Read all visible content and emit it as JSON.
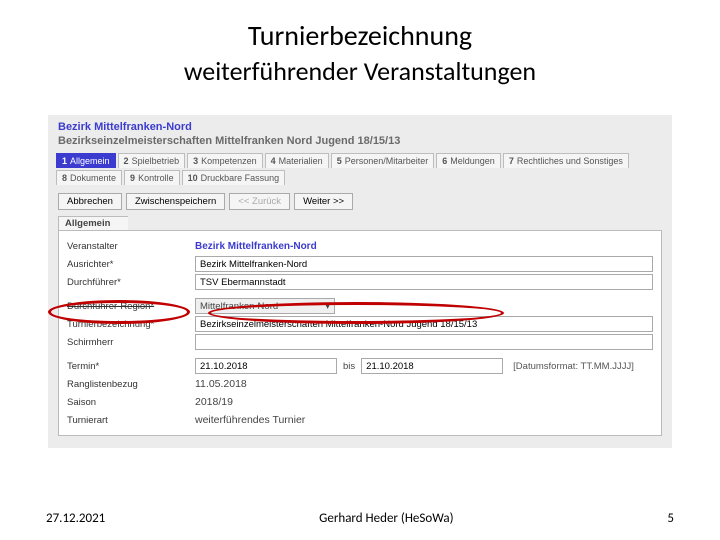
{
  "title": {
    "main": "Turnierbezeichnung",
    "sub": "weiterführender Veranstaltungen"
  },
  "header": {
    "region": "Bezirk Mittelfranken-Nord",
    "tournament": "Bezirkseinzelmeisterschaften Mittelfranken Nord Jugend 18/15/13"
  },
  "tabs": [
    {
      "num": "1",
      "label": "Allgemein",
      "active": true
    },
    {
      "num": "2",
      "label": "Spielbetrieb",
      "active": false
    },
    {
      "num": "3",
      "label": "Kompetenzen",
      "active": false
    },
    {
      "num": "4",
      "label": "Materialien",
      "active": false
    },
    {
      "num": "5",
      "label": "Personen/Mitarbeiter",
      "active": false
    },
    {
      "num": "6",
      "label": "Meldungen",
      "active": false
    },
    {
      "num": "7",
      "label": "Rechtliches und Sonstiges",
      "active": false
    },
    {
      "num": "8",
      "label": "Dokumente",
      "active": false
    },
    {
      "num": "9",
      "label": "Kontrolle",
      "active": false
    },
    {
      "num": "10",
      "label": "Druckbare Fassung",
      "active": false
    }
  ],
  "buttons": {
    "cancel": "Abbrechen",
    "save_interim": "Zwischenspeichern",
    "back": "<< Zurück",
    "next": "Weiter >>"
  },
  "section": {
    "general": "Allgemein"
  },
  "form": {
    "veranstalter_lbl": "Veranstalter",
    "veranstalter_val": "Bezirk Mittelfranken-Nord",
    "ausrichter_lbl": "Ausrichter*",
    "ausrichter_val": "Bezirk Mittelfranken-Nord",
    "durchfuehrer_lbl": "Durchführer*",
    "durchfuehrer_val": "TSV Ebermannstadt",
    "durchregion_lbl": "Durchführer-Region*",
    "durchregion_val": "Mittelfranken-Nord",
    "turnierbez_lbl": "Turnierbezeichnung*",
    "turnierbez_val": "Bezirkseinzelmeisterschaften Mittelfranken-Nord Jugend 18/15/13",
    "schirmherr_lbl": "Schirmherr",
    "termin_lbl": "Termin*",
    "termin_from": "21.10.2018",
    "termin_until_word": "bis",
    "termin_to": "21.10.2018",
    "termin_fmt": "[Datumsformat: TT.MM.JJJJ]",
    "ranglisten_lbl": "Ranglistenbezug",
    "ranglisten_val": "11.05.2018",
    "saison_lbl": "Saison",
    "saison_val": "2018/19",
    "turnierart_lbl": "Turnierart",
    "turnierart_val": "weiterführendes Turnier"
  },
  "footer": {
    "date": "27.12.2021",
    "author": "Gerhard Heder (HeSoWa)",
    "page": "5"
  },
  "icons": {
    "dropdown": "▾"
  }
}
